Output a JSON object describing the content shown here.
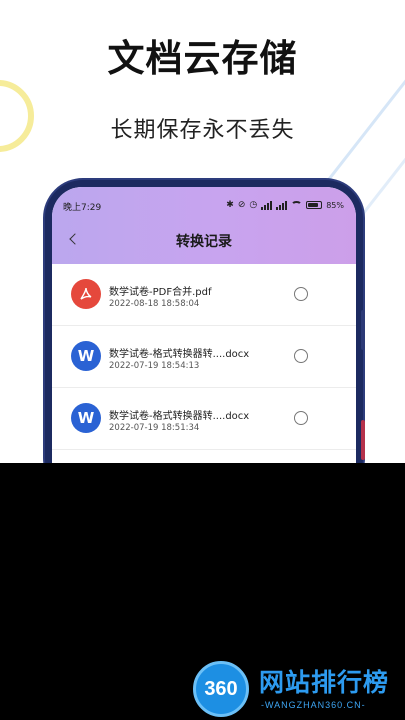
{
  "promo": {
    "headline": "文档云存储",
    "subline": "长期保存永不丢失"
  },
  "status_bar": {
    "time": "晚上7:29",
    "battery": "85%",
    "icons": [
      "bluetooth-icon",
      "alarm-off-icon",
      "alarm-icon",
      "signal-icon",
      "signal-icon",
      "wifi-icon",
      "battery-icon"
    ]
  },
  "app": {
    "title": "转换记录",
    "back_icon": "chevron-left-icon"
  },
  "files": [
    {
      "type": "pdf",
      "icon_glyph": "",
      "name": "数学试卷-PDF合并.pdf",
      "date": "2022-08-18 18:58:04"
    },
    {
      "type": "word",
      "icon_glyph": "W",
      "name": "数学试卷-格式转换器转....docx",
      "date": "2022-07-19 18:54:13"
    },
    {
      "type": "word",
      "icon_glyph": "W",
      "name": "数学试卷-格式转换器转....docx",
      "date": "2022-07-19 18:51:34"
    }
  ],
  "watermark": {
    "badge": "360",
    "name": "网站排行榜",
    "url": "-WANGZHAN360.CN-"
  },
  "colors": {
    "header_gradient_start": "#bba7ee",
    "header_gradient_end": "#cc9fe9",
    "pdf_icon": "#e5483c",
    "word_icon": "#2a62d4",
    "watermark_blue": "#2d9bf0"
  }
}
